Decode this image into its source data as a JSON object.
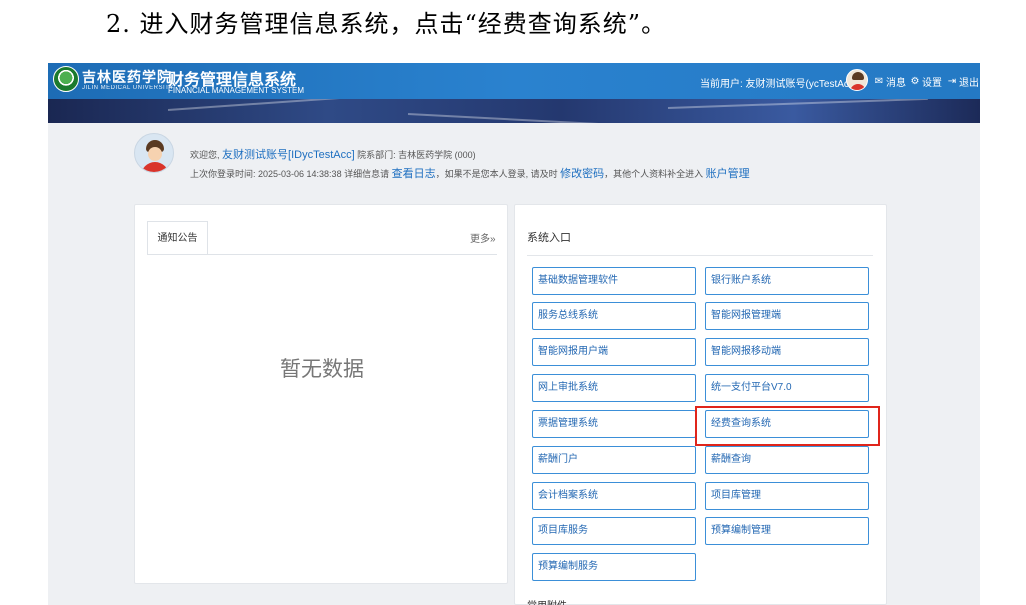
{
  "document": {
    "caption": "2. 进入财务管理信息系统，点击“经费查询系统”。"
  },
  "header": {
    "logo_icon": "university-seal-icon",
    "university_name_cn": "吉林医药学院",
    "university_name_en": "JILIN MEDICAL UNIVERSITY",
    "system_title": "财务管理信息系统",
    "system_subtitle": "FINANCIAL MANAGEMENT SYSTEM",
    "current_user": "当前用户: 友财测试账号(ycTestAcc)",
    "messages_label": "消息",
    "settings_label": "设置",
    "logout_label": "退出",
    "colors": {
      "topbar": "#2479c4",
      "band": "#24386f"
    }
  },
  "welcome": {
    "greeting": "欢迎您,",
    "user_link": "友财测试账号[IDycTestAcc]",
    "dept_label": "院系部门: 吉林医药学院 (000)",
    "last_login_prefix": "上次你登录时间: 2025-03-06 14:38:38 详细信息请",
    "view_log_link": "查看日志",
    "middle_text": "，如果不是您本人登录, 请及时",
    "change_password_link": "修改密码",
    "suffix_text": "，其他个人资料补全进入",
    "account_mgmt_link": "账户管理"
  },
  "notice_panel": {
    "tab_label": "通知公告",
    "more_link": "更多»",
    "empty_text": "暂无数据"
  },
  "systems_panel": {
    "title": "系统入口",
    "buttons": [
      "基础数据管理软件",
      "银行账户系统",
      "服务总线系统",
      "智能网报管理端",
      "智能网报用户端",
      "智能网报移动端",
      "网上审批系统",
      "统一支付平台V7.0",
      "票据管理系统",
      "经费查询系统",
      "薪酬门户",
      "薪酬查询",
      "会计档案系统",
      "项目库管理",
      "项目库服务",
      "预算编制管理",
      "预算编制服务"
    ],
    "clipped_label": "常用附件",
    "highlight_color": "#e0251b",
    "highlighted_button": "经费查询系统"
  }
}
